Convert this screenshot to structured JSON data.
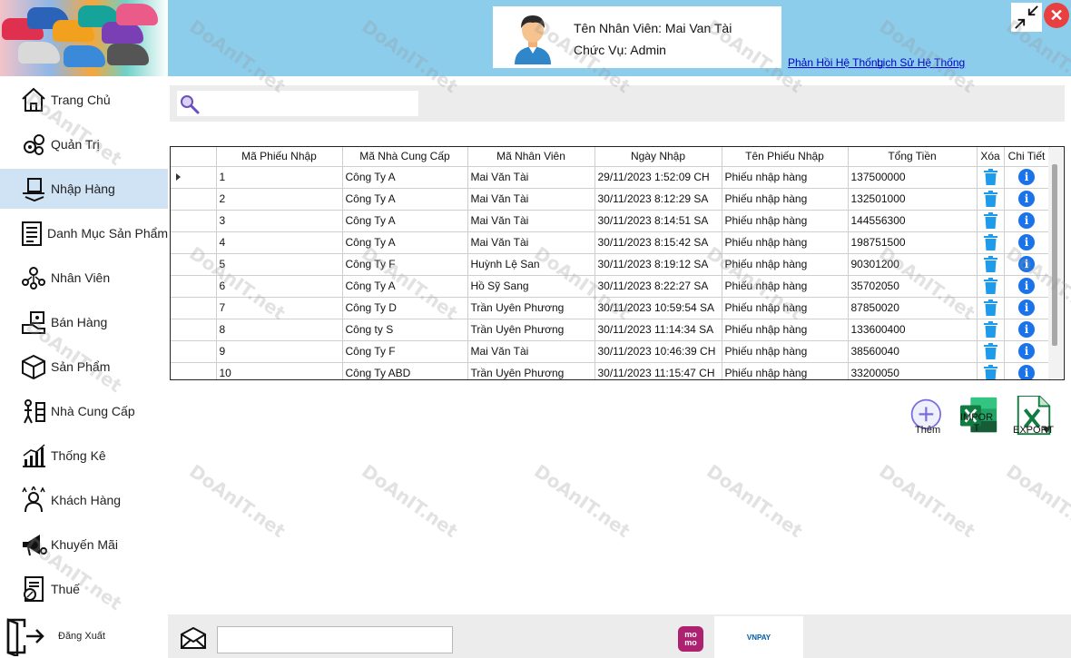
{
  "header": {
    "employee_name": "Tên Nhân Viên: Mai Van Tài",
    "employee_role": "Chức Vụ: Admin",
    "links": [
      "Phản Hồi Hệ Thống",
      "Lịch Sử Hệ Thống"
    ]
  },
  "sidebar": {
    "items": [
      {
        "label": "Trang Chủ",
        "icon": "home-icon"
      },
      {
        "label": "Quản Trị",
        "icon": "gears-icon"
      },
      {
        "label": "Nhập Hàng",
        "icon": "import-goods-icon",
        "active": true
      },
      {
        "label": "Danh Mục Sản Phẩm",
        "icon": "catalog-icon"
      },
      {
        "label": "Nhân Viên",
        "icon": "staff-icon"
      },
      {
        "label": "Bán Hàng",
        "icon": "sales-icon"
      },
      {
        "label": "Sản Phẩm",
        "icon": "box-icon"
      },
      {
        "label": "Nhà Cung Cấp",
        "icon": "supplier-icon"
      },
      {
        "label": "Thống Kê",
        "icon": "statistics-icon"
      },
      {
        "label": "Khách Hàng",
        "icon": "customers-icon"
      },
      {
        "label": "Khuyến Mãi",
        "icon": "promotion-icon"
      },
      {
        "label": "Thuế",
        "icon": "tax-icon"
      }
    ],
    "logout_label": "Đăng Xuất"
  },
  "table": {
    "columns": [
      "",
      "Mã Phiếu Nhập",
      "Mã Nhà Cung Cấp",
      "Mã Nhân Viên",
      "Ngày Nhập",
      "Tên Phiếu Nhập",
      "Tổng Tiền",
      "Xóa",
      "Chi Tiết"
    ],
    "rows": [
      [
        "1",
        "Công Ty A",
        "Mai Văn Tài",
        "29/11/2023 1:52:09 CH",
        "Phiếu nhập hàng",
        "137500000"
      ],
      [
        "2",
        "Công Ty A",
        "Mai Văn Tài",
        "30/11/2023 8:12:29 SA",
        "Phiếu nhập hàng",
        "132501000"
      ],
      [
        "3",
        "Công Ty A",
        "Mai Văn Tài",
        "30/11/2023 8:14:51 SA",
        "Phiếu nhập hàng",
        "144556300"
      ],
      [
        "4",
        "Công Ty A",
        "Mai Văn Tài",
        "30/11/2023 8:15:42 SA",
        "Phiếu nhập hàng",
        "198751500"
      ],
      [
        "5",
        "Công Ty F",
        "Huỳnh Lệ San",
        "30/11/2023 8:19:12 SA",
        "Phiếu nhập hàng",
        "90301200"
      ],
      [
        "6",
        "Công Ty A",
        "Hồ Sỹ Sang",
        "30/11/2023 8:22:27 SA",
        "Phiếu nhập hàng",
        "35702050"
      ],
      [
        "7",
        "Công Ty D",
        "Trần Uyên Phương",
        "30/11/2023 10:59:54 SA",
        "Phiếu nhập hàng",
        "87850020"
      ],
      [
        "8",
        "Công ty S",
        "Trần Uyên Phương",
        "30/11/2023 11:14:34 SA",
        "Phiếu nhập hàng",
        "133600400"
      ],
      [
        "9",
        "Công Ty F",
        "Mai Văn Tài",
        "30/11/2023 10:46:39 CH",
        "Phiếu nhập hàng",
        "38560040"
      ],
      [
        "10",
        "Công Ty ABD",
        "Trần Uyên Phương",
        "30/11/2023 11:15:47 CH",
        "Phiếu nhập hàng",
        "33200050"
      ]
    ]
  },
  "actions": {
    "add_label": "Thêm",
    "import_label": "IMPOR T",
    "export_label": "EXPORT"
  },
  "footer": {
    "momo_label": "mo mo",
    "vnpay_label": "VNPAY"
  },
  "watermark": "DoAnIT.net",
  "colors": {
    "header_bg": "#8ccdec",
    "active_nav_bg": "#cfe3f5",
    "info_blue": "#1a73e8",
    "trash_blue": "#1e9bea",
    "close_red": "#e84040",
    "excel_green": "#1d6f42",
    "momo_pink": "#ae2070"
  }
}
